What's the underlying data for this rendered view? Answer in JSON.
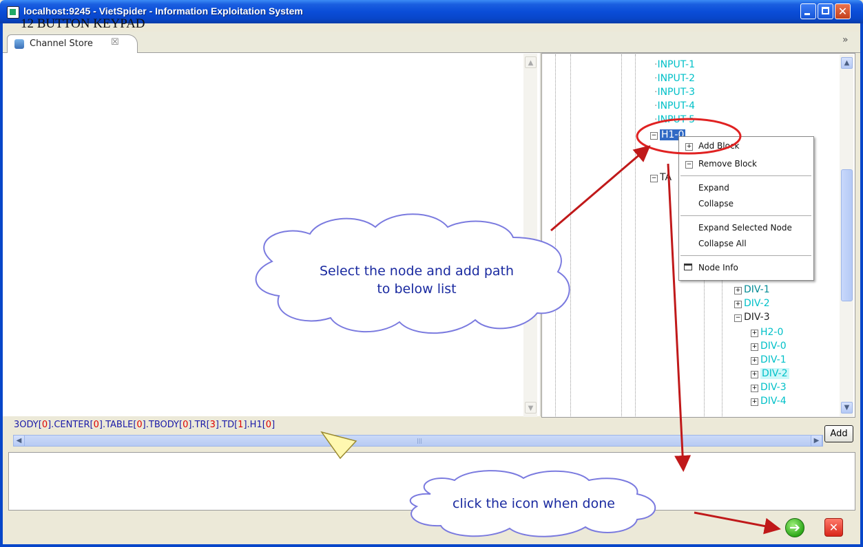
{
  "window": {
    "title": "localhost:9245 - VietSpider - Information Exploitation System"
  },
  "tabs": {
    "active_label": "Channel Store",
    "close_glyph": "☒",
    "more_glyph": "»"
  },
  "preview": {
    "heading": "12 BUTTON KEYPAD"
  },
  "tree": {
    "nodes": [
      {
        "label": "INPUT-1",
        "style": "cyan",
        "expander": ""
      },
      {
        "label": "INPUT-2",
        "style": "cyan",
        "expander": ""
      },
      {
        "label": "INPUT-3",
        "style": "cyan",
        "expander": ""
      },
      {
        "label": "INPUT-4",
        "style": "cyan",
        "expander": ""
      },
      {
        "label": "INPUT-5",
        "style": "cyan",
        "expander": ""
      },
      {
        "label": "H1-0",
        "style": "selected",
        "expander": "−"
      },
      {
        "label": "TA",
        "style": "dark",
        "expander": "−"
      },
      {
        "label": "DIV-1",
        "style": "teal",
        "expander": "+"
      },
      {
        "label": "DIV-2",
        "style": "cyan",
        "expander": "+"
      },
      {
        "label": "DIV-3",
        "style": "dark",
        "expander": "−"
      },
      {
        "label": "H2-0",
        "style": "cyan",
        "expander": "+"
      },
      {
        "label": "DIV-0",
        "style": "cyan",
        "expander": "+"
      },
      {
        "label": "DIV-1",
        "style": "cyan",
        "expander": "+"
      },
      {
        "label": "DIV-2",
        "style": "highlight",
        "expander": "+"
      },
      {
        "label": "DIV-3",
        "style": "cyan",
        "expander": "+"
      },
      {
        "label": "DIV-4",
        "style": "cyan",
        "expander": "+"
      }
    ]
  },
  "context_menu": {
    "add_block": "Add Block",
    "remove_block": "Remove Block",
    "expand": "Expand",
    "collapse": "Collapse",
    "expand_selected": "Expand Selected Node",
    "collapse_all": "Collapse All",
    "node_info": "Node Info"
  },
  "path": {
    "segments": [
      {
        "text": "3ODY",
        "idx": "0"
      },
      {
        "text": "CENTER",
        "idx": "0"
      },
      {
        "text": "TABLE",
        "idx": "0"
      },
      {
        "text": "TBODY",
        "idx": "0"
      },
      {
        "text": "TR",
        "idx": "3"
      },
      {
        "text": "TD",
        "idx": "1"
      },
      {
        "text": "H1",
        "idx": "0"
      }
    ],
    "add_label": "Add"
  },
  "annotations": {
    "cloud1_line1": "Select the node and add path",
    "cloud1_line2": "to below list",
    "cloud2": "click the icon when done"
  },
  "colors": {
    "titlebar": "#0a4dd8",
    "tree_cyan": "#00c0c8",
    "path_blue": "#1a1aa8",
    "path_index_red": "#dd0000",
    "annotation_red": "#c0191a"
  }
}
